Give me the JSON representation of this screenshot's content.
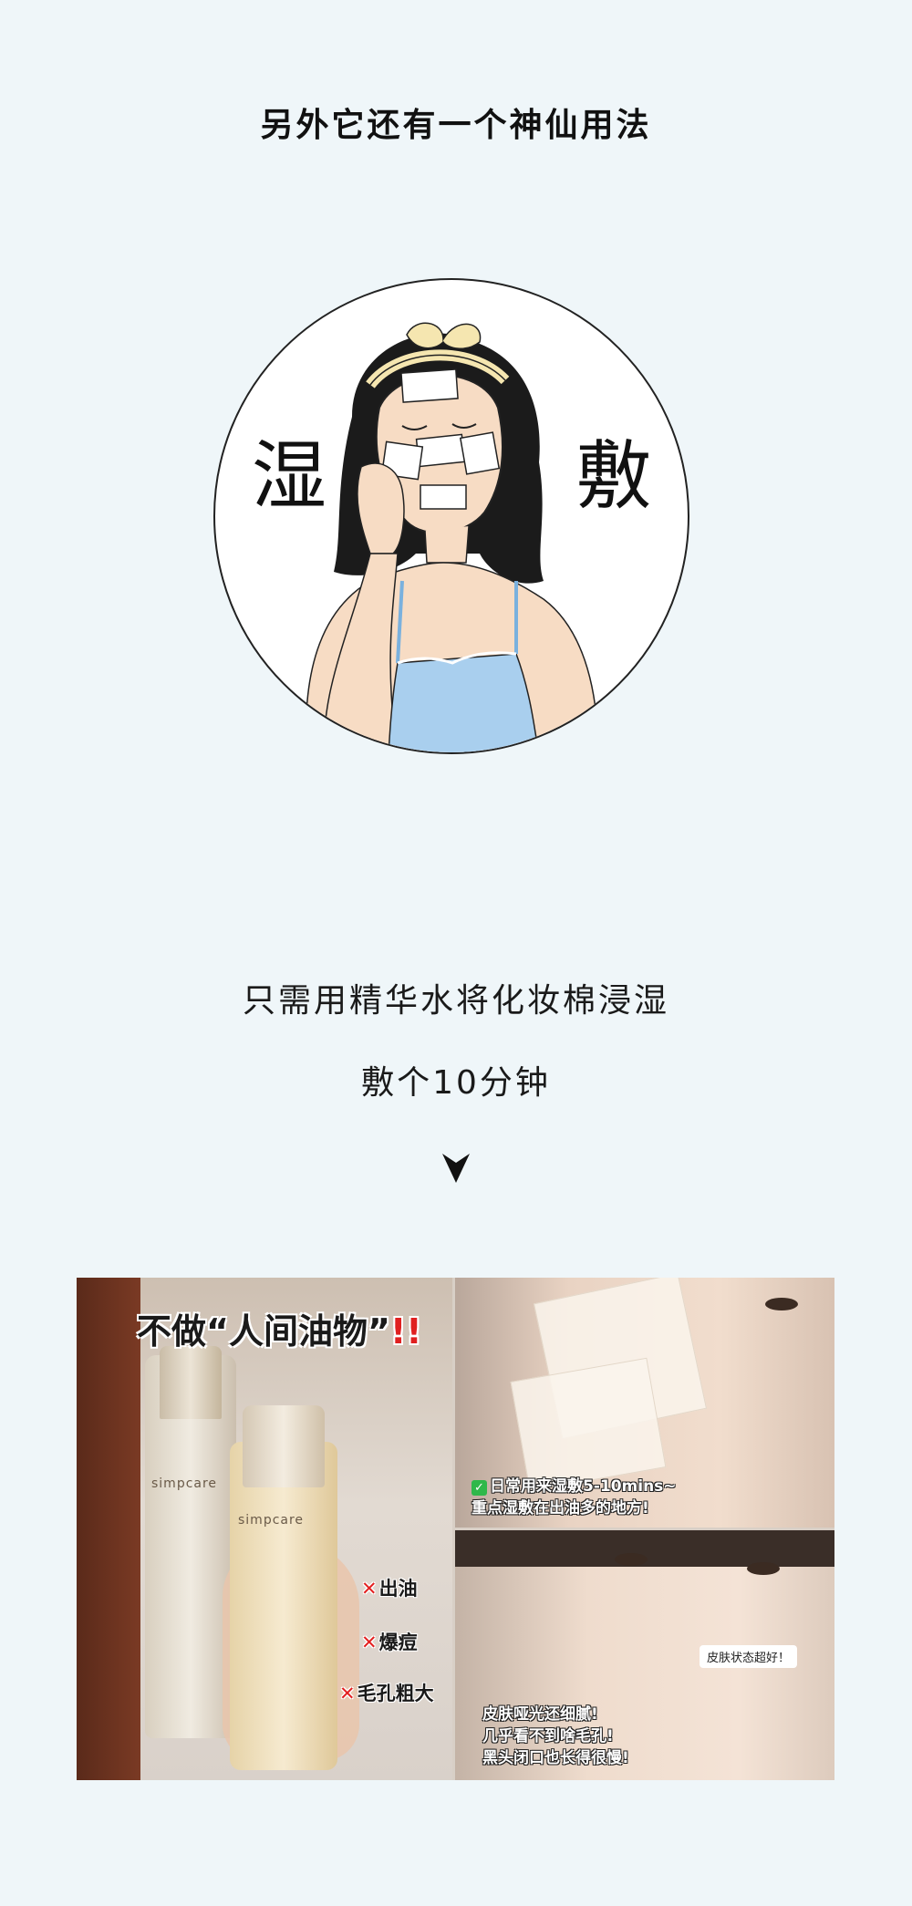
{
  "headline": "另外它还有一个神仙用法",
  "illustration": {
    "left_char": "湿",
    "right_char": "敷"
  },
  "instructions": {
    "line1": "只需用精华水将化妆棉浸湿",
    "line2": "敷个10分钟"
  },
  "arrow_icon": "down-triangle-icon",
  "photo": {
    "left_title_prefix": "不做“人间油物”",
    "left_title_bang": "!!",
    "brand": "simpcare",
    "tags": [
      "出油",
      "爆痘",
      "毛孔粗大"
    ],
    "top_caption_line1": "日常用来湿敷5-10mins~",
    "top_caption_line2": "重点湿敷在出油多的地方!",
    "bubble": "皮肤状态超好！",
    "bottom_caption_line1": "皮肤哑光还细腻!",
    "bottom_caption_line2": "几乎看不到啥毛孔!",
    "bottom_caption_line3": "黑头闭口也长得很慢!"
  },
  "colors": {
    "background": "#eff6f9",
    "accent_red": "#e02020",
    "check_green": "#2fb84a",
    "dress_blue": "#a9cfee"
  }
}
